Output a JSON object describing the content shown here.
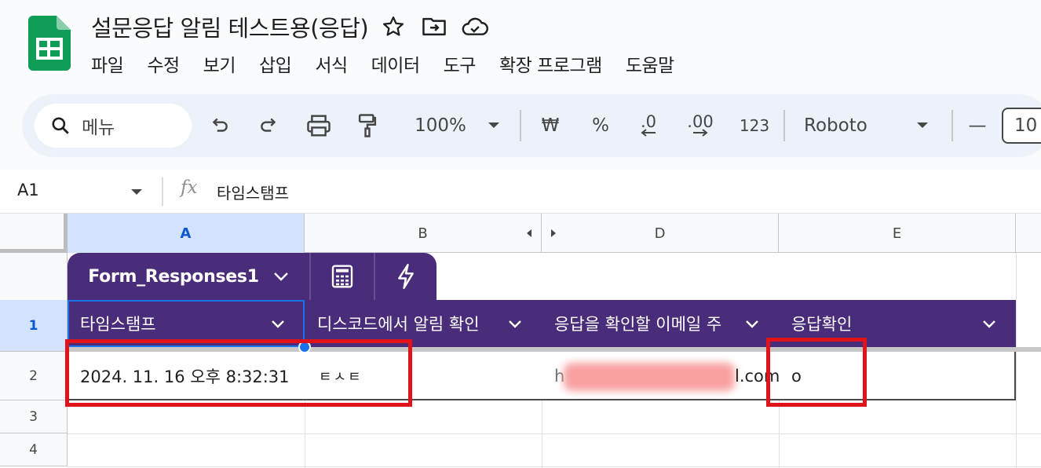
{
  "header": {
    "title": "설문응답 알림 테스트용(응답)",
    "menu": [
      "파일",
      "수정",
      "보기",
      "삽입",
      "서식",
      "데이터",
      "도구",
      "확장 프로그램",
      "도움말"
    ]
  },
  "toolbar": {
    "search_label": "메뉴",
    "zoom": "100%",
    "currency": "₩",
    "percent": "%",
    "dec_decrease": ".0",
    "dec_increase": ".00",
    "number_format": "123",
    "font": "Roboto",
    "font_size_minus": "—",
    "font_size": "10"
  },
  "formula_bar": {
    "cell_ref": "A1",
    "fx": "fx",
    "content": "타임스탬프"
  },
  "grid": {
    "columns": [
      "A",
      "B",
      "D",
      "E"
    ],
    "rows": [
      "1",
      "2",
      "3",
      "4"
    ],
    "table_name": "Form_Responses1",
    "headers": [
      "타임스탬프",
      "디스코드에서 알림 확인",
      "응답을 확인할 이메일 주",
      "응답확인"
    ],
    "row2": [
      "2024. 11. 16 오후 8:32:31",
      "ㅌㅅㅌ",
      "l.com",
      "o"
    ],
    "row2_email_visible_prefix": "h"
  },
  "colors": {
    "table_header": "#4a2d7a",
    "selection": "#1a73e8",
    "highlight": "#e0121a",
    "sheets_green": "#0f9d58"
  }
}
